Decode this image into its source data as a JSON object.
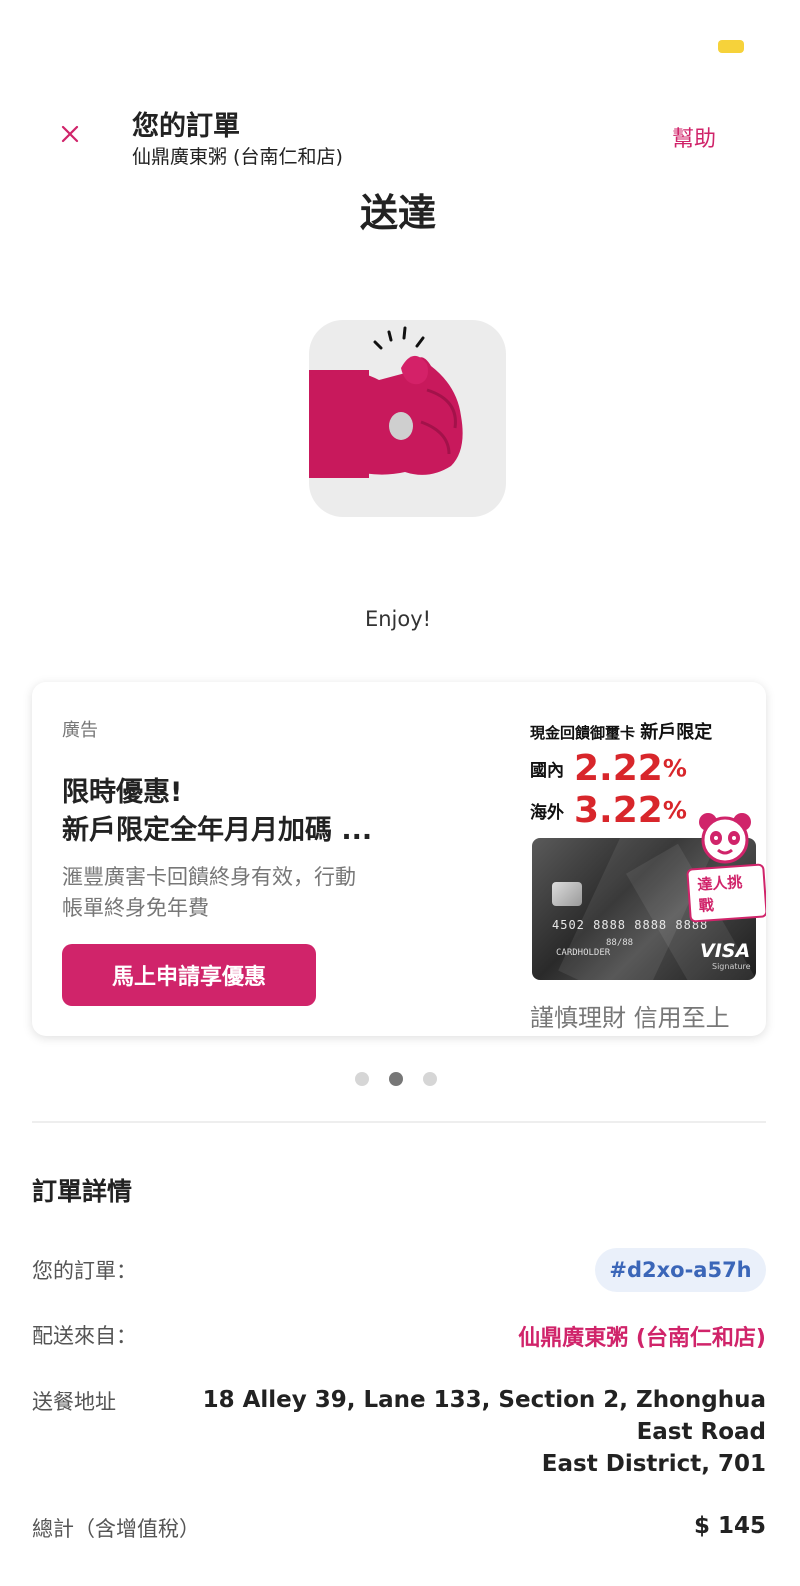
{
  "header": {
    "title": "您的訂單",
    "restaurant": "仙鼎廣東粥 (台南仁和店)",
    "help_label": "幫助"
  },
  "status": {
    "title": "送達",
    "message": "Enjoy!"
  },
  "ad": {
    "label": "廣告",
    "title": "限時優惠!\n新戶限定全年月月加碼 ...",
    "description": "滙豐廣害卡回饋終身有效，行動\n帳單終身免年費",
    "cta_label": "馬上申請享優惠",
    "promo_heading_prefix": "現金回饋御璽卡",
    "promo_heading_suffix": "新戶限定",
    "domestic_label": "國內",
    "domestic_rate": "2.22",
    "overseas_label": "海外",
    "overseas_rate": "3.22",
    "percent_sign": "%",
    "card_number": "4502 8888 8888 8888",
    "card_valid": "88/88",
    "card_holder": "CARDHOLDER",
    "card_brand": "VISA",
    "card_brand_sub": "Signature",
    "challenge_badge": "達人挑戰",
    "disclaimer": "謹慎理財 信用至上"
  },
  "carousel": {
    "count": 3,
    "active_index": 1
  },
  "details": {
    "section_title": "訂單詳情",
    "order_label": "您的訂單：",
    "order_id": "#d2xo-a57h",
    "from_label": "配送來自：",
    "from_value": "仙鼎廣東粥 (台南仁和店)",
    "address_label": "送餐地址",
    "address_line1": "18 Alley 39, Lane 133, Section 2, Zhonghua East Road",
    "address_line2": "East District, 701",
    "total_label": "總計（含增值稅）",
    "total_value": "$ 145"
  },
  "colors": {
    "brand": "#d0246a",
    "rate_red": "#d8262b",
    "order_chip_bg": "#eaf0fa",
    "order_chip_text": "#3b66b8"
  },
  "icons": {
    "close": "close-icon",
    "hero": "thumbs-up-paw-icon",
    "battery": "battery-icon"
  }
}
